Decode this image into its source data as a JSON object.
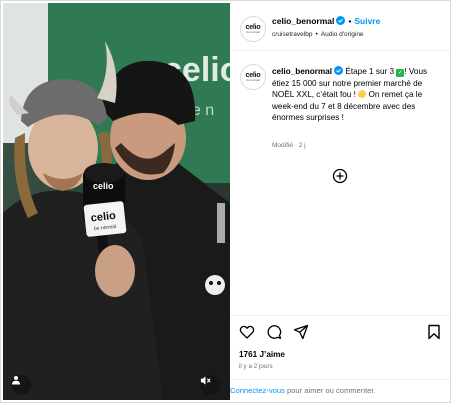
{
  "post": {
    "username": "celio_benormal",
    "follow_label": "Suivre",
    "dot": "•",
    "location": "cruisetravelbp",
    "audio": "Audio d'origine",
    "avatar_logo": "celio",
    "avatar_sub": "be normal"
  },
  "caption": {
    "username": "celio_benormal",
    "line1": "Étape 1 sur 3",
    "line1_end": "!",
    "body": "Vous étiez 15 000 sur notre premier marché de NOËL XXL, c’était fou !",
    "body2": "On remet ça le week-end du 7 et 8 décembre avec des énormes surprises !",
    "edited": "Modifié",
    "time": "2 j"
  },
  "media": {
    "brand_text": "celio",
    "brand_sub": "be normal",
    "mic_logo": "celio",
    "mic_sub": "be normal"
  },
  "stats": {
    "likes": "1761 J’aime",
    "posted": "il y a 2 jours"
  },
  "login": {
    "link": "Connectez-vous",
    "rest": " pour aimer ou commenter."
  },
  "icons": {
    "verified": "verified-badge-icon",
    "add_comment": "plus-circle-icon",
    "like": "heart-icon",
    "comment": "comment-icon",
    "share": "paper-plane-icon",
    "save": "bookmark-icon",
    "tag": "user-tag-icon",
    "mute": "muted-speaker-icon"
  },
  "colors": {
    "accent": "#0095f6",
    "verified": "#0095f6",
    "muted_text": "#737373"
  }
}
